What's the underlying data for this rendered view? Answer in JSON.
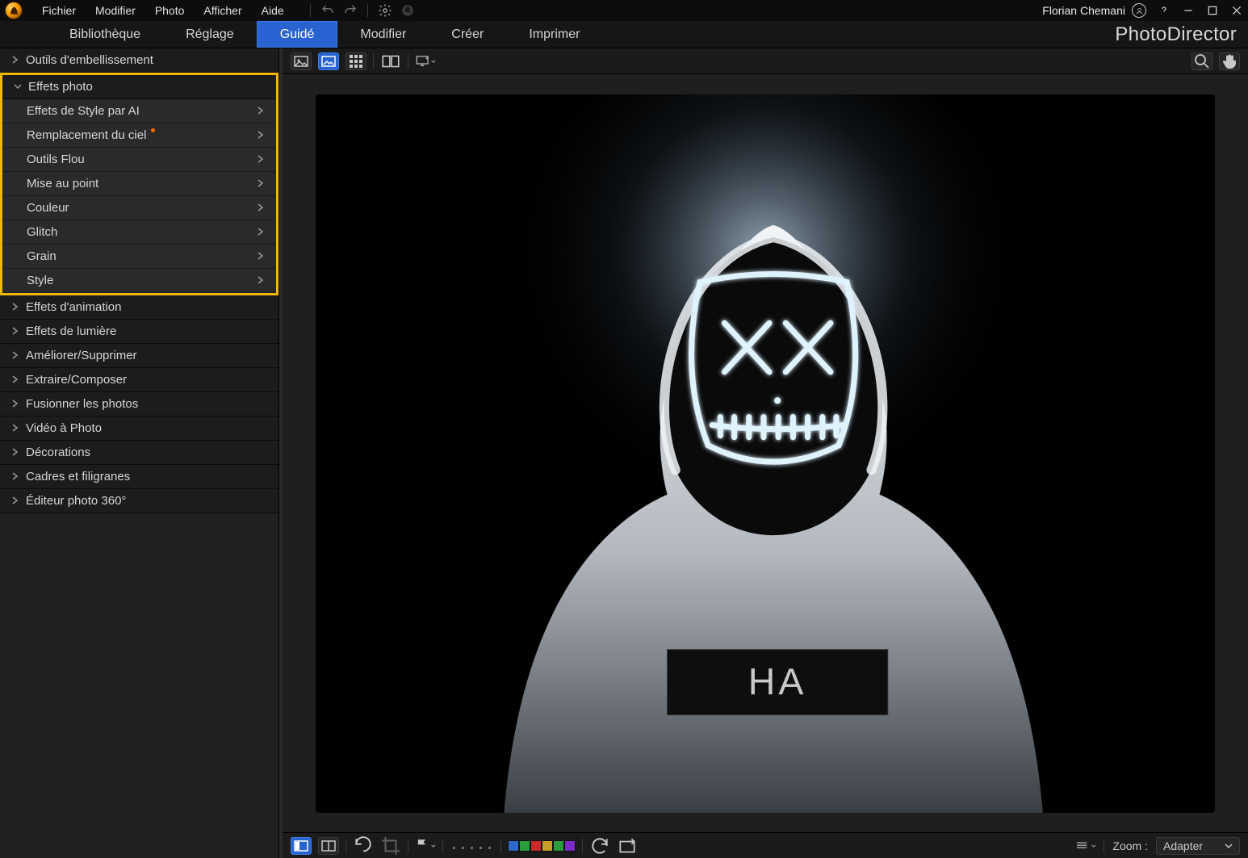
{
  "app": {
    "name": "PhotoDirector"
  },
  "user": {
    "name": "Florian Chemani"
  },
  "menubar": {
    "items": [
      {
        "label": "Fichier"
      },
      {
        "label": "Modifier"
      },
      {
        "label": "Photo"
      },
      {
        "label": "Afficher"
      },
      {
        "label": "Aide"
      }
    ]
  },
  "main_tabs": {
    "items": [
      {
        "label": "Bibliothèque",
        "active": false
      },
      {
        "label": "Réglage",
        "active": false
      },
      {
        "label": "Guidé",
        "active": true
      },
      {
        "label": "Modifier",
        "active": false
      },
      {
        "label": "Créer",
        "active": false
      },
      {
        "label": "Imprimer",
        "active": false
      }
    ]
  },
  "sidebar": {
    "categories": [
      {
        "label": "Outils d'embellissement",
        "expanded": false
      },
      {
        "label": "Effets photo",
        "expanded": true,
        "highlighted": true,
        "children": [
          {
            "label": "Effets de Style par AI",
            "new": false
          },
          {
            "label": "Remplacement du ciel",
            "new": true
          },
          {
            "label": "Outils Flou"
          },
          {
            "label": "Mise au point"
          },
          {
            "label": "Couleur"
          },
          {
            "label": "Glitch"
          },
          {
            "label": "Grain"
          },
          {
            "label": "Style"
          }
        ]
      },
      {
        "label": "Effets d'animation",
        "expanded": false
      },
      {
        "label": "Effets de lumière",
        "expanded": false
      },
      {
        "label": "Améliorer/Supprimer",
        "expanded": false
      },
      {
        "label": "Extraire/Composer",
        "expanded": false
      },
      {
        "label": "Fusionner les photos",
        "expanded": false
      },
      {
        "label": "Vidéo à Photo",
        "expanded": false
      },
      {
        "label": "Décorations",
        "expanded": false
      },
      {
        "label": "Cadres et filigranes",
        "expanded": false
      },
      {
        "label": "Éditeur photo 360°",
        "expanded": false
      }
    ]
  },
  "canvas": {
    "view_mode_selected": "fit-window",
    "image_description": "Person in white hoodie wearing a neon X-eyes stitched-mouth mask on black background"
  },
  "bottom": {
    "swatch_colors": [
      "#2f66c9",
      "#2a9c3d",
      "#c92a2a",
      "#c99f2a",
      "#2a9cc9",
      "#7c2ac9"
    ],
    "zoom_label": "Zoom :",
    "zoom_value": "Adapter"
  }
}
